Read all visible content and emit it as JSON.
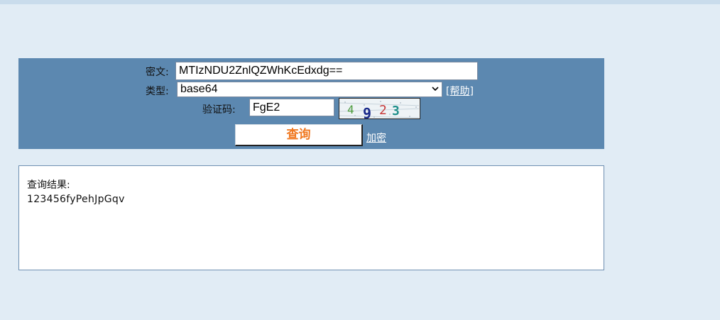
{
  "form": {
    "cipher_label": "密文:",
    "cipher_value": "MTIzNDU2ZnlQZWhKcEdxdg==",
    "type_label": "类型:",
    "type_value": "base64",
    "help_link": "[帮助]",
    "captcha_label": "验证码:",
    "captcha_value": "FgE2",
    "captcha_chars": [
      "4",
      "9",
      "2",
      "3"
    ],
    "query_button": "查询",
    "encrypt_link": "加密"
  },
  "result": {
    "title": "查询结果:",
    "value": "123456fyPehJpGqv"
  },
  "colors": {
    "background": "#e1ecf5",
    "panel": "#5c88b0",
    "button_text": "#f07820"
  }
}
